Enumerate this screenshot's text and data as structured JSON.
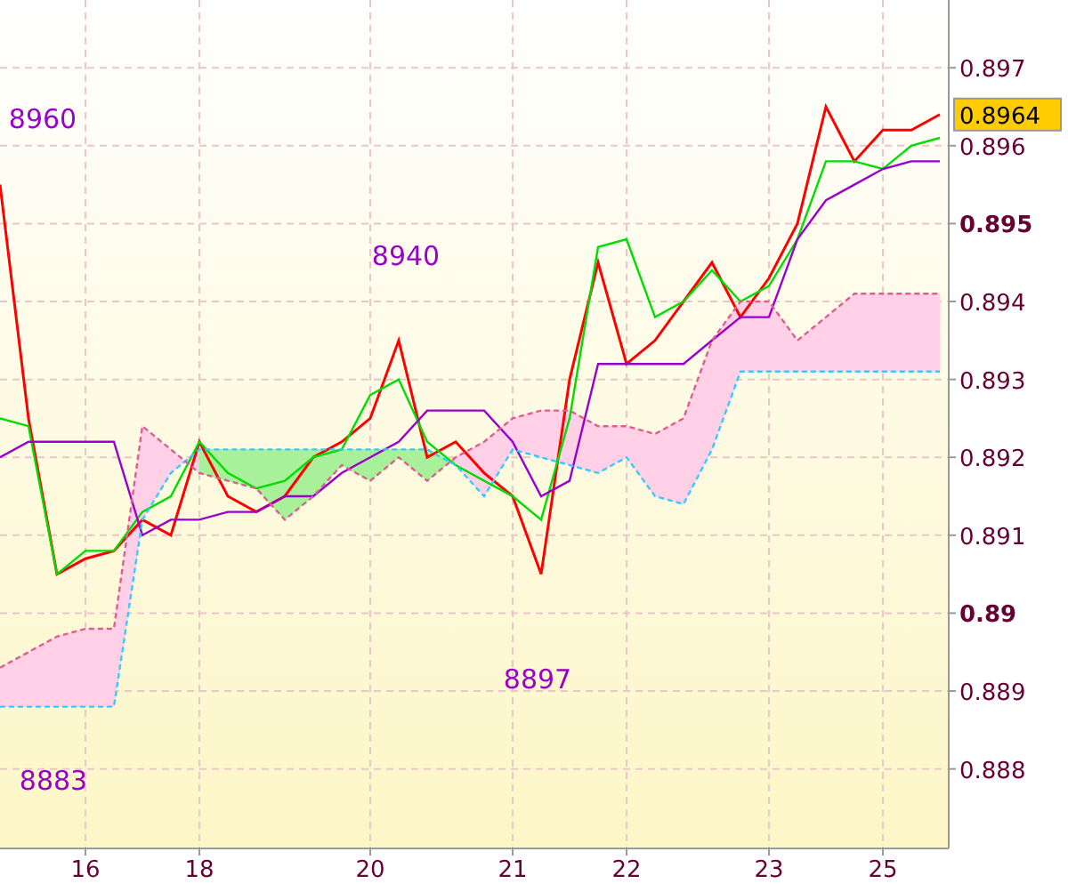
{
  "chart_data": {
    "type": "line",
    "ylim": [
      0.88698,
      0.89787
    ],
    "grid": true,
    "yticks": [
      {
        "value": 0.897,
        "label": "0.897"
      },
      {
        "value": 0.896,
        "label": "0.896"
      },
      {
        "value": 0.895,
        "label": "0.895"
      },
      {
        "value": 0.894,
        "label": "0.894"
      },
      {
        "value": 0.893,
        "label": "0.893"
      },
      {
        "value": 0.892,
        "label": "0.892"
      },
      {
        "value": 0.891,
        "label": "0.891"
      },
      {
        "value": 0.89,
        "label": "0.89"
      },
      {
        "value": 0.889,
        "label": "0.889"
      },
      {
        "value": 0.888,
        "label": "0.888"
      }
    ],
    "categories": [
      null,
      null,
      null,
      "16",
      null,
      null,
      null,
      "18",
      null,
      null,
      null,
      null,
      null,
      "20",
      null,
      null,
      null,
      null,
      "21",
      null,
      null,
      null,
      "22",
      null,
      null,
      null,
      null,
      "23",
      null,
      null,
      null,
      "25",
      null,
      null
    ],
    "series": [
      {
        "color": "#ff0000",
        "line_style": "solid",
        "values": [
          0.8955,
          0.8925,
          0.8905,
          0.8907,
          0.8908,
          0.8912,
          0.891,
          0.8922,
          0.8915,
          0.8913,
          0.8915,
          0.892,
          0.8922,
          0.8925,
          0.8935,
          0.892,
          0.8922,
          0.8918,
          0.8915,
          0.8905,
          0.893,
          0.8945,
          0.8932,
          0.8935,
          0.894,
          0.8945,
          0.8938,
          0.8943,
          0.895,
          0.8965,
          0.8958,
          0.8962,
          0.8962,
          0.8964
        ]
      },
      {
        "color": "#00dd00",
        "line_style": "solid",
        "values": [
          0.8925,
          0.8924,
          0.8905,
          0.8908,
          0.8908,
          0.8913,
          0.8915,
          0.8922,
          0.8918,
          0.8916,
          0.8917,
          0.892,
          0.8921,
          0.8928,
          0.893,
          0.8922,
          0.8919,
          0.8917,
          0.8915,
          0.8912,
          0.8925,
          0.8947,
          0.8948,
          0.8938,
          0.894,
          0.8944,
          0.894,
          0.8942,
          0.8948,
          0.8958,
          0.8958,
          0.8957,
          0.896,
          0.8961
        ]
      },
      {
        "color": "#9900cc",
        "line_style": "solid",
        "values": [
          0.892,
          0.8922,
          0.8922,
          0.8922,
          0.8922,
          0.891,
          0.8912,
          0.8912,
          0.8913,
          0.8913,
          0.8915,
          0.8915,
          0.8918,
          0.892,
          0.8922,
          0.8926,
          0.8926,
          0.8926,
          0.8922,
          0.8915,
          0.8917,
          0.8932,
          0.8932,
          0.8932,
          0.8932,
          0.8935,
          0.8938,
          0.8938,
          0.8948,
          0.8953,
          0.8955,
          0.8957,
          0.8958,
          0.8958
        ]
      },
      {
        "color": "#33ccff",
        "line_style": "dashed",
        "values": [
          0.8888,
          0.8888,
          0.8888,
          0.8888,
          0.8888,
          0.8912,
          0.8918,
          0.8921,
          0.8921,
          0.8921,
          0.8921,
          0.8921,
          0.8921,
          0.8921,
          0.8921,
          0.8921,
          0.8919,
          0.8915,
          0.8921,
          0.892,
          0.8919,
          0.8918,
          0.892,
          0.8915,
          0.8914,
          0.8921,
          0.8931,
          0.8931,
          0.8931,
          0.8931,
          0.8931,
          0.8931,
          0.8931,
          0.8931
        ]
      },
      {
        "color": "#d9608f",
        "line_style": "dashed",
        "values": [
          0.8893,
          0.8895,
          0.8897,
          0.8898,
          0.8898,
          0.8924,
          0.8921,
          0.8918,
          0.8917,
          0.8916,
          0.8912,
          0.8915,
          0.8919,
          0.8917,
          0.892,
          0.8917,
          0.892,
          0.8922,
          0.8925,
          0.8926,
          0.8926,
          0.8924,
          0.8924,
          0.8923,
          0.8925,
          0.8935,
          0.894,
          0.894,
          0.8935,
          0.8938,
          0.8941,
          0.8941,
          0.8941,
          0.8941
        ]
      }
    ],
    "annotations": [
      "8960",
      "8940",
      "8897",
      "8883"
    ]
  },
  "last_price_label": "0.8964"
}
